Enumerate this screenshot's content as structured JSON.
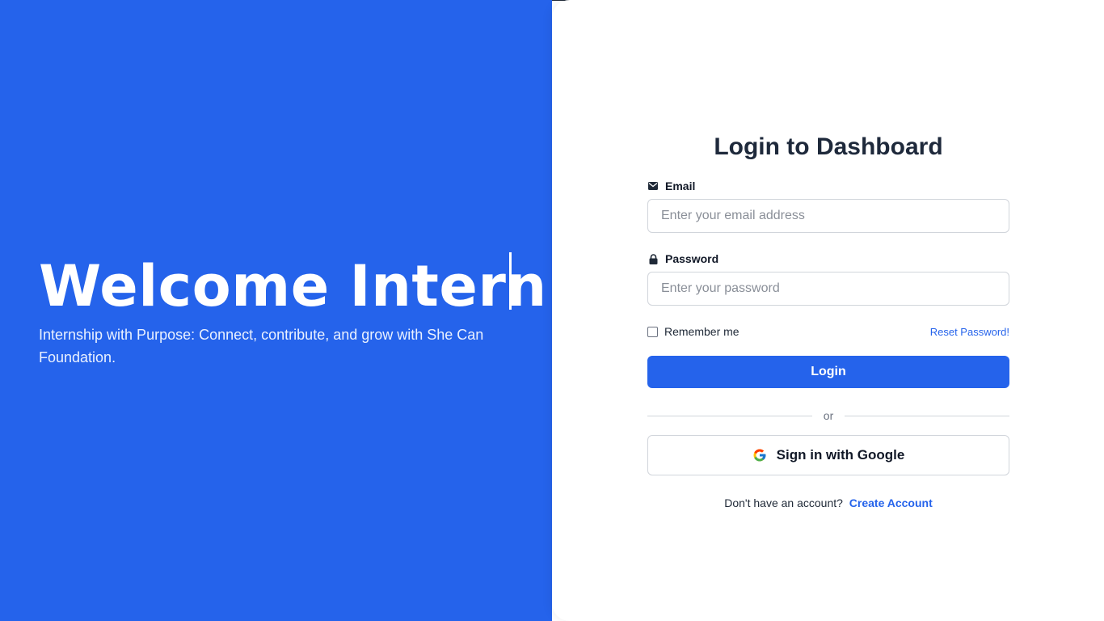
{
  "hero": {
    "title": "Welcome Intern!",
    "subtitle": "Internship with Purpose: Connect, contribute, and grow with She Can Foundation."
  },
  "login": {
    "title": "Login to Dashboard",
    "email_label": "Email",
    "email_placeholder": "Enter your email address",
    "email_value": "",
    "password_label": "Password",
    "password_placeholder": "Enter your password",
    "password_value": "",
    "remember_label": "Remember me",
    "remember_checked": false,
    "reset_link": "Reset Password!",
    "login_button": "Login",
    "divider_text": "or",
    "google_button": "Sign in with Google",
    "signup_prompt": "Don't have an account?",
    "signup_link": "Create Account"
  },
  "icons": {
    "email": "envelope-icon",
    "password": "lock-icon",
    "google": "google-icon"
  },
  "colors": {
    "primary": "#2563eb",
    "heading": "#1e293b",
    "text": "#111827",
    "border": "#d1d5db",
    "background": "#ffffff"
  }
}
